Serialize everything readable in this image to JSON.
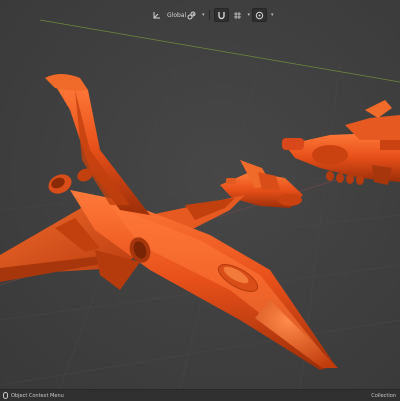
{
  "header": {
    "transform_orientation": "Global",
    "transform_icon": "axes-icon",
    "pivot_icon": "link-icon",
    "snap_icon": "magnet-icon",
    "snap_increment_icon": "grid-snap-icon",
    "proportional_icon": "proportional-edit-icon"
  },
  "status_bar": {
    "left_label": "Object Context Menu",
    "right_label": "Collection"
  },
  "viewport": {
    "background_color": "#3f3f3f",
    "grid_line_color": "#5a5a5a",
    "x_axis_color": "#8a4a4a",
    "y_axis_color": "#6f8a3a",
    "model_color": "#e8501a"
  }
}
